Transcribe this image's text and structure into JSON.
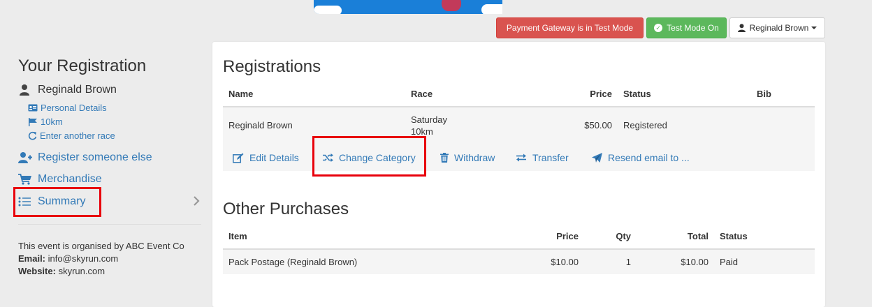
{
  "topbar": {
    "test_gateway_label": "Payment Gateway is in Test Mode",
    "test_mode_label": "Test Mode On",
    "user_label": "Reginald Brown"
  },
  "sidebar": {
    "title": "Your Registration",
    "user_name": "Reginald Brown",
    "sub_items": [
      {
        "label": "Personal Details",
        "icon": "id-card-icon"
      },
      {
        "label": "10km",
        "icon": "flag-icon"
      },
      {
        "label": "Enter another race",
        "icon": "refresh-icon"
      }
    ],
    "main_items": [
      {
        "label": "Register someone else",
        "icon": "user-plus-icon"
      },
      {
        "label": "Merchandise",
        "icon": "cart-icon"
      },
      {
        "label": "Summary",
        "icon": "list-icon"
      }
    ],
    "organiser_text": "This event is organised by ABC Event Co",
    "email_label": "Email:",
    "email_value": "info@skyrun.com",
    "website_label": "Website:",
    "website_value": "skyrun.com"
  },
  "registrations": {
    "title": "Registrations",
    "headers": {
      "name": "Name",
      "race": "Race",
      "price": "Price",
      "status": "Status",
      "bib": "Bib"
    },
    "rows": [
      {
        "name": "Reginald Brown",
        "race_day": "Saturday",
        "race_distance": "10km",
        "price": "$50.00",
        "status": "Registered",
        "bib": ""
      }
    ],
    "actions": {
      "edit": "Edit Details",
      "change_category": "Change Category",
      "withdraw": "Withdraw",
      "transfer": "Transfer",
      "resend": "Resend email to ..."
    }
  },
  "other_purchases": {
    "title": "Other Purchases",
    "headers": {
      "item": "Item",
      "price": "Price",
      "qty": "Qty",
      "total": "Total",
      "status": "Status"
    },
    "rows": [
      {
        "item": "Pack Postage (Reginald Brown)",
        "price": "$10.00",
        "qty": "1",
        "total": "$10.00",
        "status": "Paid"
      }
    ]
  },
  "colors": {
    "link": "#337ab7",
    "danger": "#d9534f",
    "success": "#5cb85c",
    "highlight": "#e8000b"
  }
}
